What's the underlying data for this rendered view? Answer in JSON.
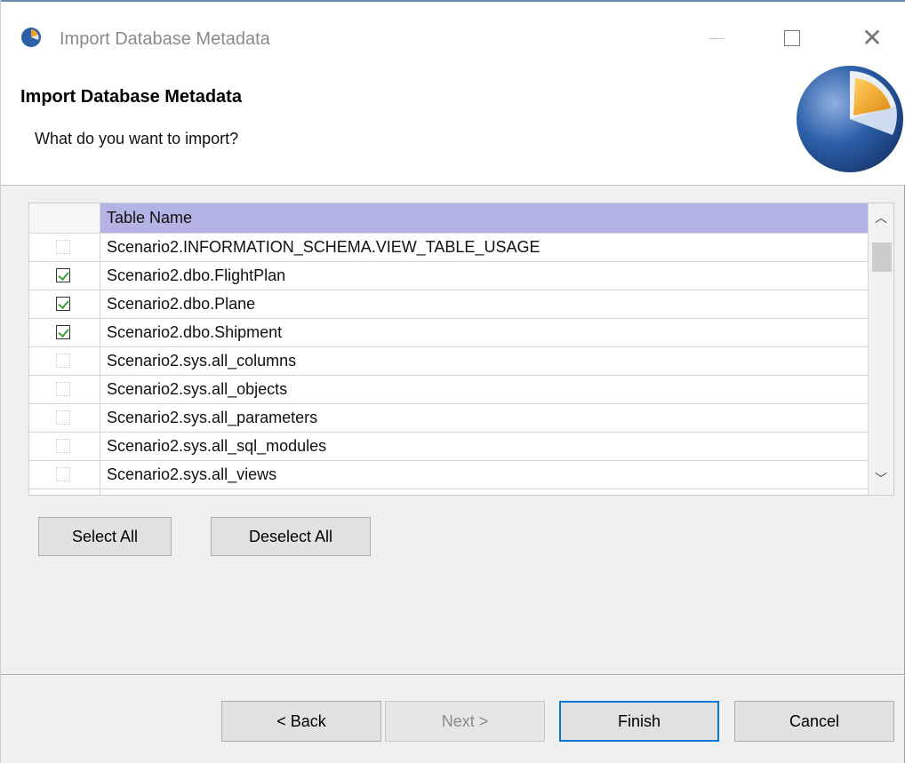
{
  "window": {
    "title": "Import Database Metadata"
  },
  "banner": {
    "title": "Import Database Metadata",
    "subtitle": "What do you want to import?"
  },
  "table": {
    "header": "Table Name",
    "rows": [
      {
        "name": "Scenario2.INFORMATION_SCHEMA.VIEW_TABLE_USAGE",
        "checked": false
      },
      {
        "name": "Scenario2.dbo.FlightPlan",
        "checked": true
      },
      {
        "name": "Scenario2.dbo.Plane",
        "checked": true
      },
      {
        "name": "Scenario2.dbo.Shipment",
        "checked": true
      },
      {
        "name": "Scenario2.sys.all_columns",
        "checked": false
      },
      {
        "name": "Scenario2.sys.all_objects",
        "checked": false
      },
      {
        "name": "Scenario2.sys.all_parameters",
        "checked": false
      },
      {
        "name": "Scenario2.sys.all_sql_modules",
        "checked": false
      },
      {
        "name": "Scenario2.sys.all_views",
        "checked": false
      },
      {
        "name": "",
        "checked": false
      }
    ]
  },
  "selection_buttons": {
    "select_all": "Select All",
    "deselect_all": "Deselect All"
  },
  "footer": {
    "back": "< Back",
    "next": "Next >",
    "finish": "Finish",
    "cancel": "Cancel"
  },
  "icons": {
    "app": "app-logo-icon",
    "banner": "wizard-logo-icon"
  },
  "colors": {
    "header_highlight": "#b3b3e6",
    "check_green": "#3aa33a",
    "default_button_border": "#0078d7",
    "logo_blue": "#2c5fa8",
    "logo_orange": "#f0a020"
  }
}
